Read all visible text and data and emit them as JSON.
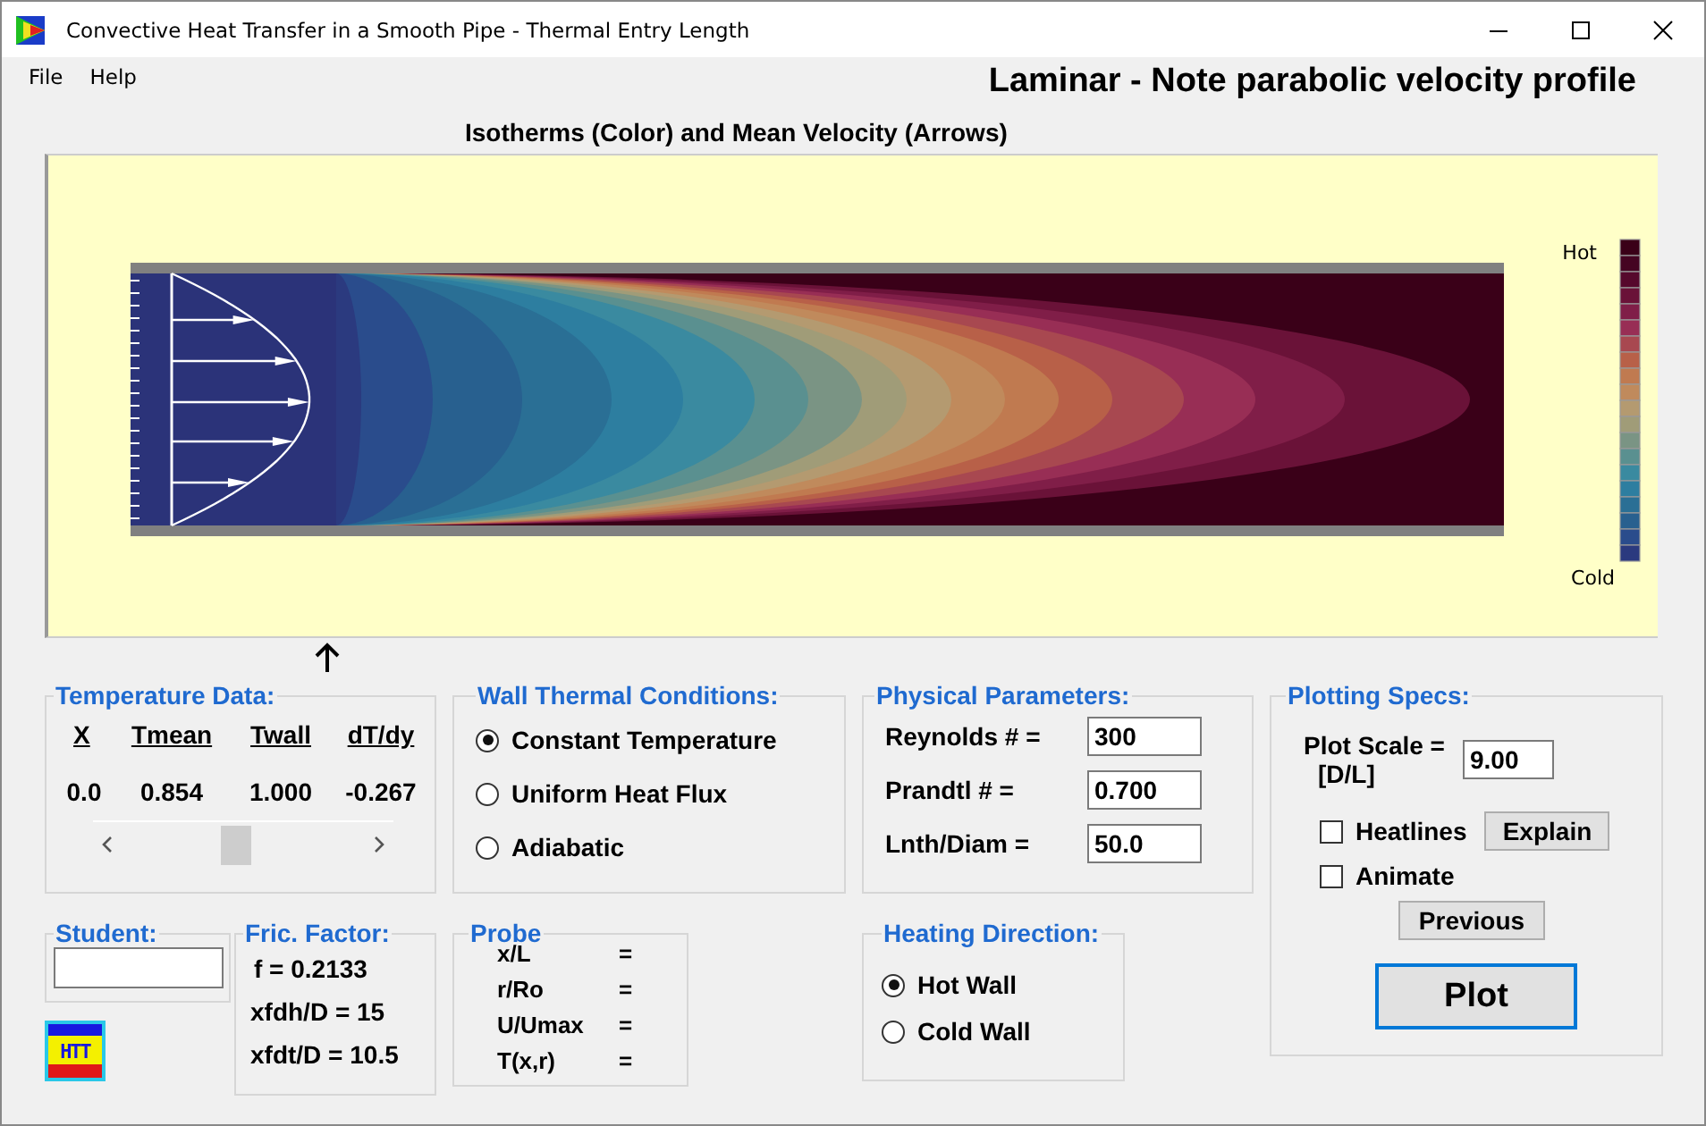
{
  "window": {
    "title": "Convective Heat Transfer in a Smooth Pipe - Thermal Entry Length"
  },
  "menu": [
    {
      "label": "File"
    },
    {
      "label": "Help"
    }
  ],
  "flow_regime": "Laminar - Note parabolic velocity profile",
  "plot": {
    "title": "Isotherms (Color) and Mean Velocity (Arrows)",
    "legend_hot": "Hot",
    "legend_cold": "Cold"
  },
  "temperature_data": {
    "title": "Temperature Data:",
    "columns": [
      "X",
      "Tmean",
      "Twall",
      "dT/dy"
    ],
    "values": [
      "0.0",
      "0.854",
      "1.000",
      "-0.267"
    ],
    "position": {
      "level": 0.47
    }
  },
  "wall_conditions": {
    "title": "Wall Thermal Conditions:",
    "options": [
      {
        "label": "Constant Temperature",
        "selected": true
      },
      {
        "label": "Uniform Heat Flux",
        "selected": false
      },
      {
        "label": "Adiabatic",
        "selected": false
      }
    ]
  },
  "physical_parameters": {
    "title": "Physical Parameters:",
    "fields": [
      {
        "label": "Reynolds #  =",
        "value": "300"
      },
      {
        "label": "Prandtl #  =",
        "value": "0.700"
      },
      {
        "label": "Lnth/Diam =",
        "value": "50.0"
      }
    ]
  },
  "plotting_specs": {
    "title": "Plotting Specs:",
    "scale_label": "Plot Scale =",
    "scale_unit": "[D/L]",
    "scale_value": "9.00",
    "heatlines": {
      "label": "Heatlines",
      "checked": false
    },
    "explain_button": "Explain",
    "animate": {
      "label": "Animate",
      "checked": false
    },
    "previous_button": "Previous",
    "plot_button": "Plot"
  },
  "student": {
    "title": "Student:"
  },
  "logo": "HTT",
  "friction_factor": {
    "title": "Fric. Factor:",
    "lines": [
      "f = 0.2133",
      "xfdh/D = 15",
      "xfdt/D = 10.5"
    ]
  },
  "probe": {
    "title": "Probe",
    "lines": [
      {
        "label": "x/L",
        "sign": "="
      },
      {
        "label": "r/Ro",
        "sign": "="
      },
      {
        "label": "U/Umax",
        "sign": "="
      },
      {
        "label": "T(x,r)",
        "sign": "="
      }
    ]
  },
  "heating_direction": {
    "title": "Heating Direction:",
    "options": [
      {
        "label": "Hot Wall",
        "selected": true
      },
      {
        "label": "Cold Wall",
        "selected": false
      }
    ]
  }
}
